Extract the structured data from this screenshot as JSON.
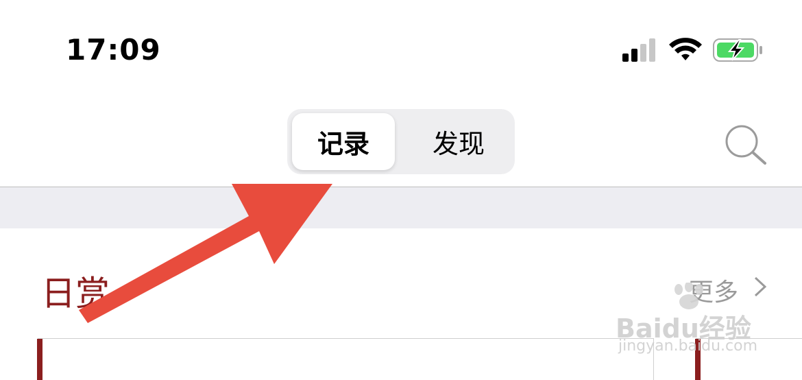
{
  "status_bar": {
    "time": "17:09",
    "icons": [
      "cellular-signal-icon",
      "wifi-icon",
      "battery-charging-icon"
    ],
    "battery_color": "#4cd964"
  },
  "header": {
    "segmented": {
      "options": [
        {
          "label": "记录",
          "selected": true
        },
        {
          "label": "发现",
          "selected": false
        }
      ]
    },
    "search_icon": "search-icon"
  },
  "section": {
    "title": "日赏",
    "more_label": "更多",
    "more_icon": "chevron-right-icon",
    "title_color": "#8b1e1e"
  },
  "annotation": {
    "arrow_color": "#e84c3d"
  },
  "watermark": {
    "brand": "Baidu经验",
    "url": "jingyan.baidu.com"
  }
}
